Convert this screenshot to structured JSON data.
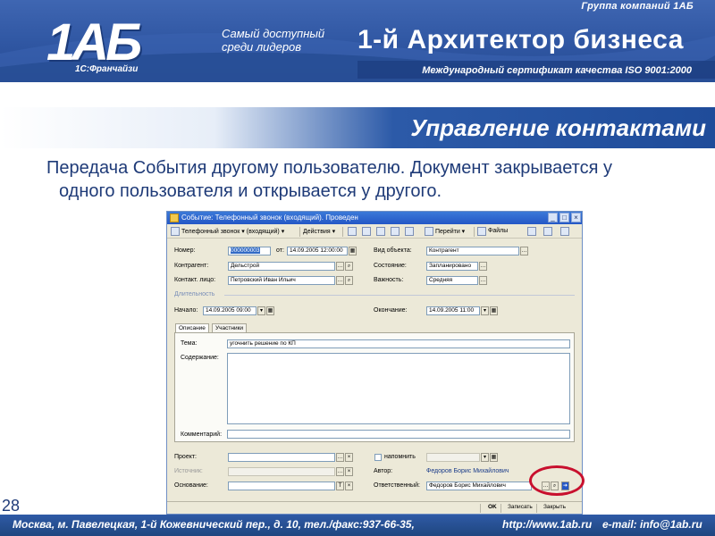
{
  "header": {
    "group_name": "Группа компаний 1АБ",
    "logo_text": "1АБ",
    "logo_sub": "1С:Франчайзи",
    "slogan": "Самый доступный среди лидеров",
    "brand": "1-й Архитектор бизнеса",
    "iso": "Международный сертификат качества ISO 9001:2000"
  },
  "slide": {
    "title": "Управление контактами",
    "body": "Передача События другому пользователю. Документ закрывается у одного пользователя и открывается у другого.",
    "page_number": "28"
  },
  "footer": {
    "address": "Москва, м. Павелецкая, 1-й Кожевнический пер., д. 10, тел./факс:937-66-35,",
    "url": "http://www.1ab.ru",
    "email": "e-mail: info@1ab.ru"
  },
  "window": {
    "title": "Событие: Телефонный звонок (входящий). Проведен",
    "toolbar": {
      "event_type": "Телефонный звонок ▾ (входящий) ▾",
      "actions": "Действия ▾",
      "goto": "Перейти ▾",
      "files": "Файлы"
    },
    "fields": {
      "number_label": "Номер:",
      "number_value": "000000003",
      "date_label": "от:",
      "date_value": "14.09.2005 12:00:00",
      "object_kind_label": "Вид объекта:",
      "object_kind_value": "Контрагент",
      "contractor_label": "Контрагент:",
      "contractor_value": "Дельстрой",
      "state_label": "Состояние:",
      "state_value": "Запланировано",
      "contact_label": "Контакт. лицо:",
      "contact_value": "Петровский Иван Ильич",
      "importance_label": "Важность:",
      "importance_value": "Средняя",
      "duration_section": "Длительность",
      "start_label": "Начало:",
      "start_value": "14.09.2005 09:00",
      "end_label": "Окончание:",
      "end_value": "14.09.2005 11:00"
    },
    "tabs": [
      "Описание",
      "Участники"
    ],
    "description": {
      "topic_label": "Тема:",
      "topic_value": "угочнить решение по КП",
      "content_label": "Содержание:",
      "comment_label": "Комментарий:"
    },
    "bottom": {
      "project_label": "Проект:",
      "remind_label": "напомнить",
      "source_label": "Источник:",
      "author_label": "Автор:",
      "author_value": "Федоров Борис Михайлович",
      "basis_label": "Основание:",
      "responsible_label": "Ответственный:",
      "responsible_value": "Федоров Борис Михайлович"
    },
    "buttons": {
      "ok": "OK",
      "write": "Записать",
      "close": "Закрыть"
    }
  },
  "colors": {
    "brand_blue": "#2f56a2",
    "text_blue": "#1f3b78",
    "highlight_circle": "#c8102e"
  }
}
